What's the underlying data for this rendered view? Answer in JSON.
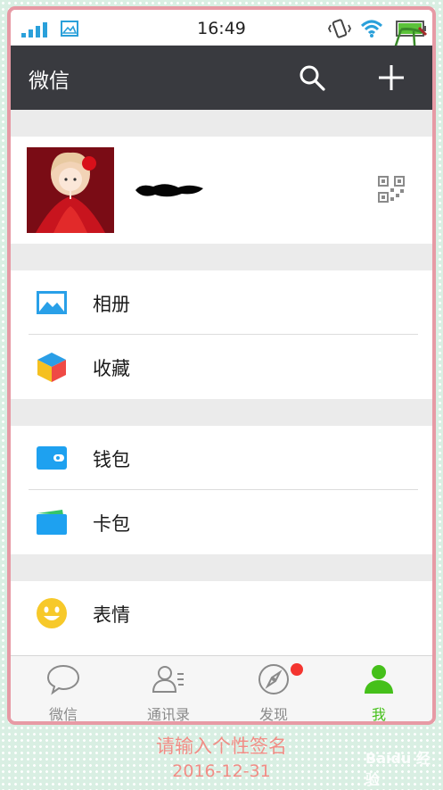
{
  "status_bar": {
    "time": "16:49"
  },
  "header": {
    "title": "微信"
  },
  "menu": {
    "album": "相册",
    "favorites": "收藏",
    "wallet": "钱包",
    "cards": "卡包",
    "stickers": "表情"
  },
  "tabs": {
    "chats": "微信",
    "contacts": "通讯录",
    "discover": "发现",
    "me": "我"
  },
  "footer": {
    "signature": "请输入个性签名",
    "date": "2016-12-31",
    "watermark": "Baidu 经验"
  },
  "colors": {
    "title_bar": "#393a3f",
    "accent_green": "#45c01a",
    "icon_blue": "#2aa0da",
    "badge_red": "#f43530",
    "frame_pink": "#e79aa5"
  }
}
